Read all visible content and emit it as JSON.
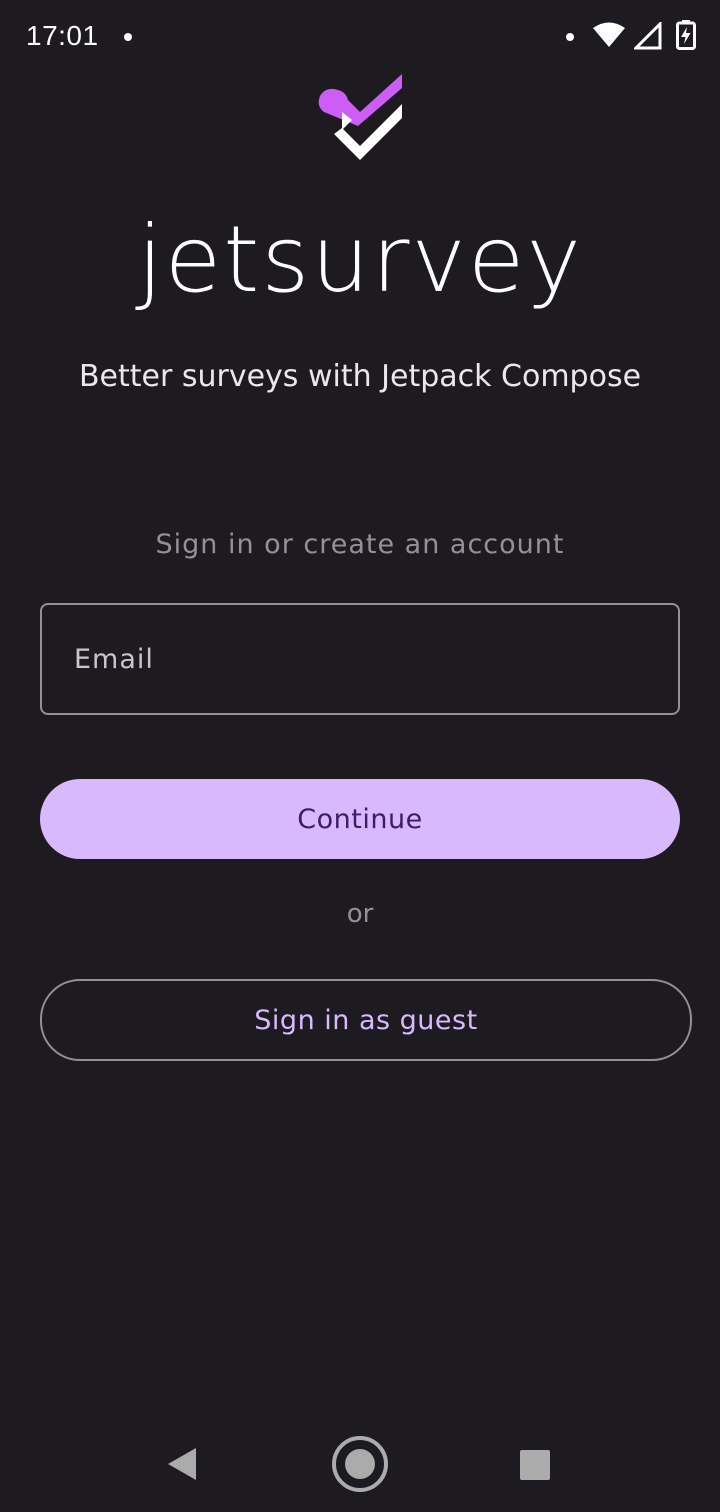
{
  "status_bar": {
    "time": "17:01",
    "icons": [
      "notification-dot-icon",
      "wifi-icon",
      "cell-signal-icon",
      "battery-charging-icon"
    ]
  },
  "app": {
    "logo_icon": "jetsurvey-logo-icon",
    "name": "jetsurvey",
    "tagline": "Better surveys with Jetpack Compose"
  },
  "signin": {
    "prompt": "Sign in or create an account",
    "email_placeholder": "Email",
    "email_value": "",
    "continue_label": "Continue",
    "or_label": "or",
    "guest_label": "Sign in as guest"
  },
  "nav_bar": {
    "icons": [
      "back-icon",
      "home-icon",
      "recents-icon"
    ]
  },
  "colors": {
    "background": "#1e1b20",
    "primary": "#d8b9fd",
    "on_primary": "#3f1a6e",
    "outline": "#958f99",
    "logo_accent": "#cc5ef5"
  }
}
